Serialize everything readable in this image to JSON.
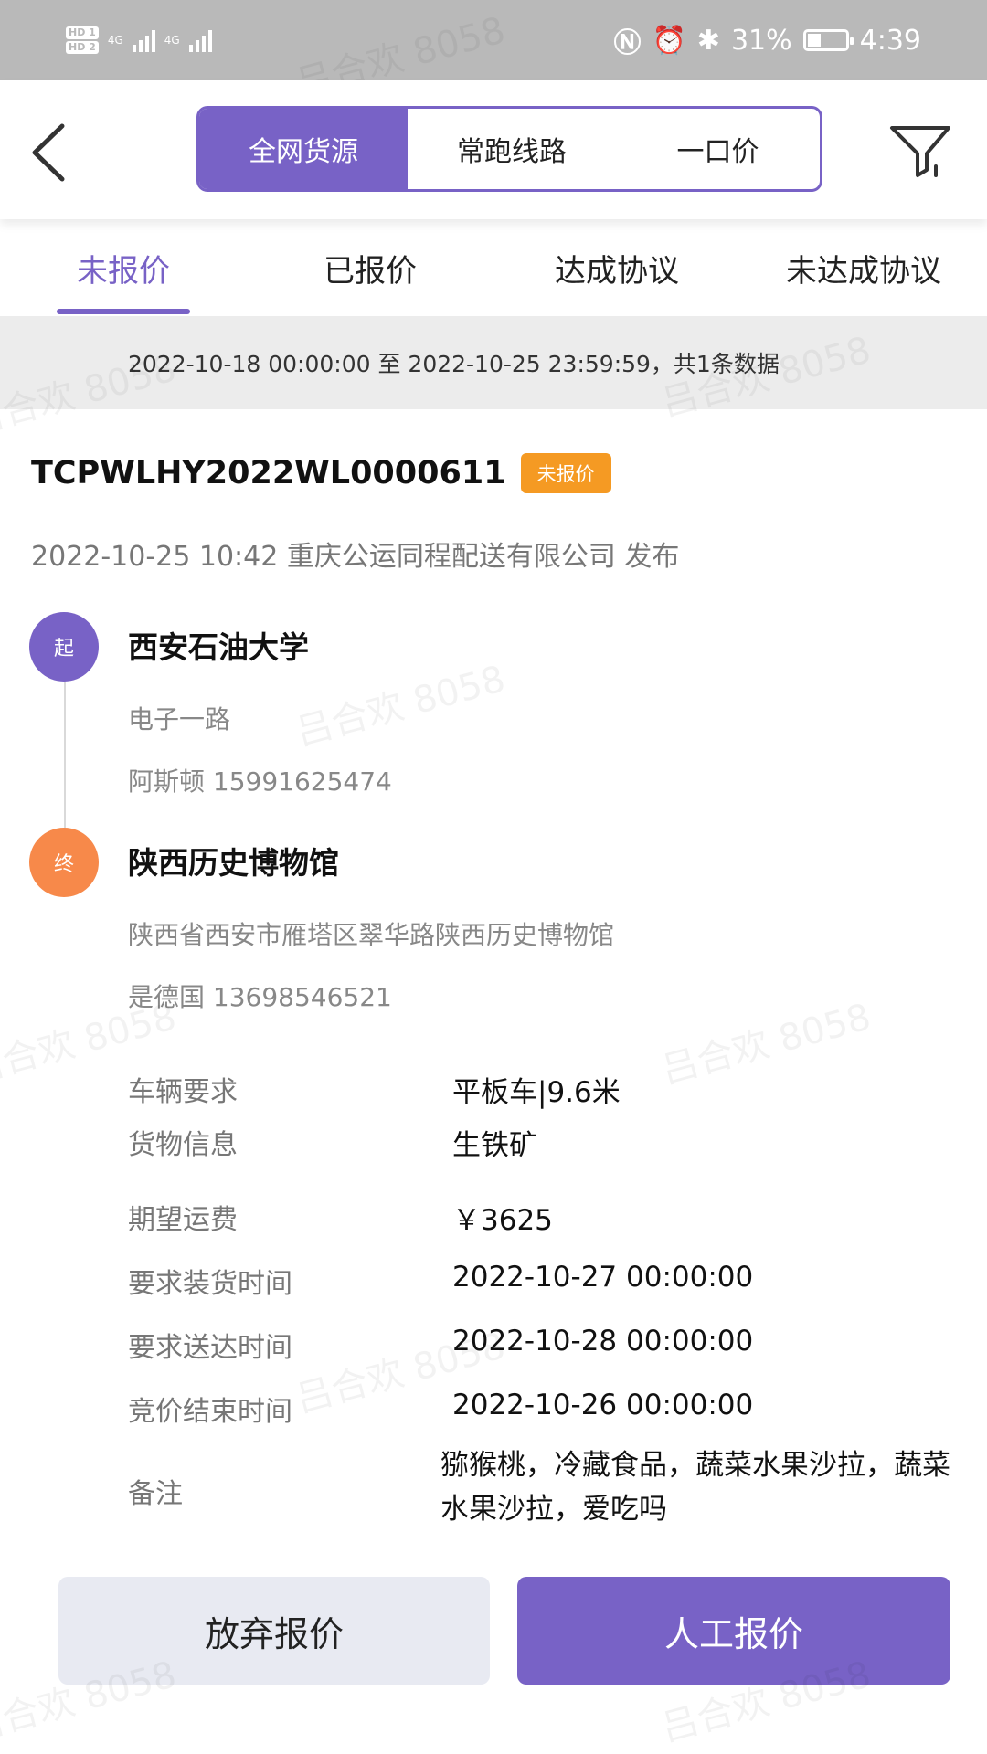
{
  "status_bar": {
    "hd1": "HD 1",
    "hd2": "HD 2",
    "net1": "4G",
    "net2": "4G",
    "battery_percent": "31%",
    "time": "4:39"
  },
  "header": {
    "segments": [
      "全网货源",
      "常跑线路",
      "一口价"
    ],
    "active_segment": 0
  },
  "tabs": {
    "items": [
      "未报价",
      "已报价",
      "达成协议",
      "未达成协议"
    ],
    "active": 0
  },
  "date_range": "2022-10-18 00:00:00 至 2022-10-25 23:59:59，共1条数据",
  "order": {
    "number": "TCPWLHY2022WL0000611",
    "status": "未报价",
    "publish_line": "2022-10-25 10:42 重庆公运同程配送有限公司 发布",
    "start": {
      "marker": "起",
      "name": "西安石油大学",
      "address": "电子一路",
      "contact": "阿斯顿 15991625474"
    },
    "end": {
      "marker": "终",
      "name": "陕西历史博物馆",
      "address": "陕西省西安市雁塔区翠华路陕西历史博物馆",
      "contact": "是德国 13698546521"
    },
    "details": [
      {
        "label": "车辆要求",
        "value": "平板车|9.6米"
      },
      {
        "label": "货物信息",
        "value": "生铁矿"
      },
      {
        "label": "期望运费",
        "value": "￥3625"
      },
      {
        "label": "要求装货时间",
        "value": "2022-10-27 00:00:00"
      },
      {
        "label": "要求送达时间",
        "value": "2022-10-28 00:00:00"
      },
      {
        "label": "竞价结束时间",
        "value": "2022-10-26 00:00:00"
      }
    ],
    "remark_label": "备注",
    "remark_value": "猕猴桃，冷藏食品，蔬菜水果沙拉，蔬菜水果沙拉，爱吃吗"
  },
  "actions": {
    "abandon": "放弃报价",
    "manual": "人工报价"
  },
  "watermark": "吕合欢 8058",
  "colors": {
    "accent": "#7862c6",
    "badge": "#f59a23",
    "end_marker": "#f7894a"
  }
}
